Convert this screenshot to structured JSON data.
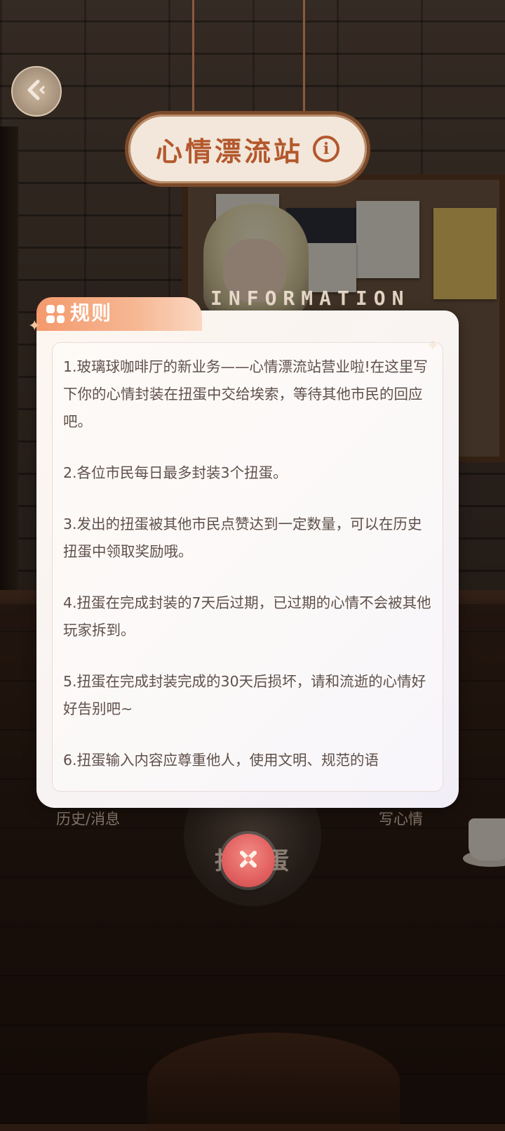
{
  "header": {
    "title": "心情漂流站",
    "info_icon_text": "i"
  },
  "modal": {
    "tab_title": "规则",
    "banner_text": "INFORMATION",
    "rules": [
      "1.玻璃球咖啡厅的新业务——心情漂流站营业啦!在这里写下你的心情封装在扭蛋中交给埃索，等待其他市民的回应吧。",
      "2.各位市民每日最多封装3个扭蛋。",
      "3.发出的扭蛋被其他市民点赞达到一定数量，可以在历史扭蛋中领取奖励哦。",
      "4.扭蛋在完成封装的7天后过期，已过期的心情不会被其他玩家拆到。",
      "5.扭蛋在完成封装完成的30天后损坏，请和流逝的心情好好告别吧~",
      "6.扭蛋输入内容应尊重他人，使用文明、规范的语"
    ]
  },
  "background_actions": {
    "history_label": "历史/消息",
    "draw_label": "抽扭蛋",
    "write_label": "写心情"
  },
  "icons": {
    "back": "back-arrow-icon",
    "info": "info-icon",
    "close": "close-x-icon",
    "tab": "four-squares-icon"
  },
  "colors": {
    "title_text": "#b4582d",
    "tab_gradient_start": "#f49a6c",
    "close_button": "#e1605f",
    "rule_text": "#5f504a"
  }
}
